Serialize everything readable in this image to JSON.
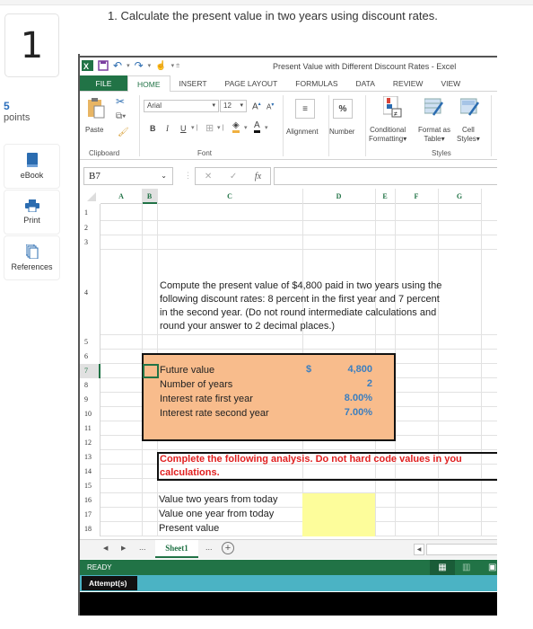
{
  "question": {
    "number": "1",
    "text": "1. Calculate the present value in two years using discount rates.",
    "points_value": "5",
    "points_label": "points"
  },
  "sidebar": {
    "items": [
      {
        "label": "eBook",
        "icon": "book-icon"
      },
      {
        "label": "Print",
        "icon": "printer-icon"
      },
      {
        "label": "References",
        "icon": "references-icon"
      }
    ]
  },
  "excel": {
    "window_title": "Present Value with Different Discount Rates - Excel",
    "ribbon_tabs": [
      "FILE",
      "HOME",
      "INSERT",
      "PAGE LAYOUT",
      "FORMULAS",
      "DATA",
      "REVIEW",
      "VIEW"
    ],
    "active_tab": "HOME",
    "ribbon": {
      "paste": "Paste",
      "clipboard": "Clipboard",
      "font_name": "Arial",
      "font_size": "12",
      "font_group": "Font",
      "bold": "B",
      "italic": "I",
      "underline": "U",
      "alignment": "Alignment",
      "number": "Number",
      "number_icon": "%",
      "conditional_formatting": [
        "Conditional",
        "Formatting"
      ],
      "format_as_table": [
        "Format as",
        "Table"
      ],
      "cell_styles": [
        "Cell",
        "Styles"
      ],
      "styles_group": "Styles"
    },
    "formula_bar": {
      "name_box": "B7",
      "fx": "fx",
      "value": ""
    },
    "columns": [
      "A",
      "B",
      "C",
      "D",
      "E",
      "F",
      "G"
    ],
    "selected_column": "B",
    "rows": [
      "1",
      "2",
      "3",
      "4",
      "5",
      "6",
      "7",
      "8",
      "9",
      "10",
      "11",
      "12",
      "13",
      "14",
      "15",
      "16",
      "17",
      "18"
    ],
    "selected_row": "7",
    "problem_text": [
      "Compute the present value of $4,800 paid in two years using the",
      "following discount rates: 8 percent in the first year and 7 percent",
      "in the second year. (Do not round intermediate calculations and",
      "round your answer to 2 decimal places.)"
    ],
    "inputs": [
      {
        "label": "Future value",
        "currency": "$",
        "value": "4,800"
      },
      {
        "label": "Number of years",
        "currency": "",
        "value": "2"
      },
      {
        "label": "Interest rate first year",
        "currency": "",
        "value": "8.00%"
      },
      {
        "label": "Interest rate second year",
        "currency": "",
        "value": "7.00%"
      }
    ],
    "instruction": [
      "Complete the following analysis. Do not hard code values in you",
      "calculations."
    ],
    "analysis": [
      {
        "label": "Value two years from today",
        "value": ""
      },
      {
        "label": "Value one year from today",
        "value": ""
      },
      {
        "label": "Present value",
        "value": ""
      }
    ],
    "sheet_tab": "Sheet1",
    "sheet_nav_ellipsis": "...",
    "status": "READY",
    "attempts_label": "Attempt(s)"
  }
}
